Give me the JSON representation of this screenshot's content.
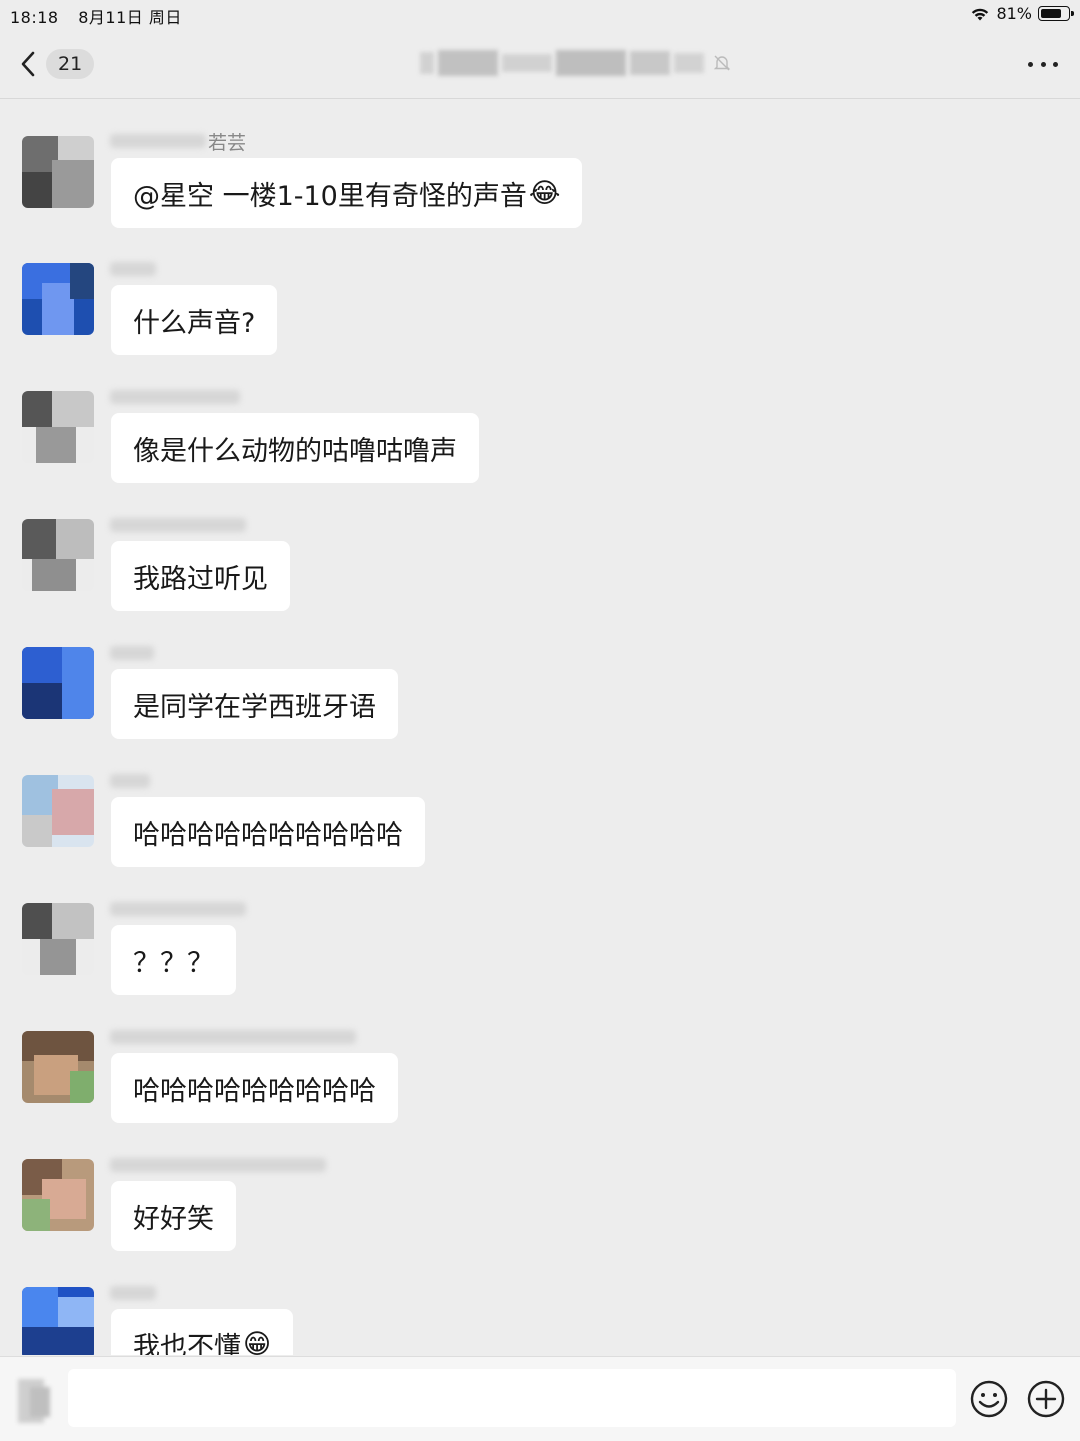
{
  "status_bar": {
    "time": "18:18",
    "date": "8月11日 周日",
    "battery": "81%",
    "battery_level": 0.81
  },
  "nav": {
    "unread_count": "21",
    "title_redacted": true,
    "muted": true
  },
  "messages": [
    {
      "sender_visible": "若芸",
      "text": "@星空 一楼1-10里有奇怪的声音",
      "emoji": "😂",
      "avatar": "manga"
    },
    {
      "sender_visible": "",
      "text": "什么声音?",
      "emoji": "",
      "avatar": "blue-space"
    },
    {
      "sender_visible": "",
      "text": "像是什么动物的咕噜咕噜声",
      "emoji": "",
      "avatar": "manga"
    },
    {
      "sender_visible": "",
      "text": "我路过听见",
      "emoji": "",
      "avatar": "manga"
    },
    {
      "sender_visible": "",
      "text": "是同学在学西班牙语",
      "emoji": "",
      "avatar": "blue-space"
    },
    {
      "sender_visible": "",
      "text": "哈哈哈哈哈哈哈哈哈哈",
      "emoji": "",
      "avatar": "pink-animal"
    },
    {
      "sender_visible": "",
      "text": "？？？",
      "emoji": "",
      "avatar": "manga"
    },
    {
      "sender_visible": "",
      "text": "哈哈哈哈哈哈哈哈哈",
      "emoji": "",
      "avatar": "photo"
    },
    {
      "sender_visible": "",
      "text": "好好笑",
      "emoji": "",
      "avatar": "photo"
    },
    {
      "sender_visible": "",
      "text": "我也不懂",
      "emoji": "😁",
      "avatar": "blue-space"
    }
  ],
  "input": {
    "placeholder": ""
  },
  "icons": {
    "back": "chevron-left-icon",
    "more": "more-dots-icon",
    "mute": "bell-off-icon",
    "emoji": "smiley-icon",
    "plus": "plus-circle-icon",
    "voice": "voice-icon"
  },
  "colors": {
    "background": "#ededed",
    "bubble": "#ffffff",
    "text": "#191919",
    "sender": "#888888"
  }
}
